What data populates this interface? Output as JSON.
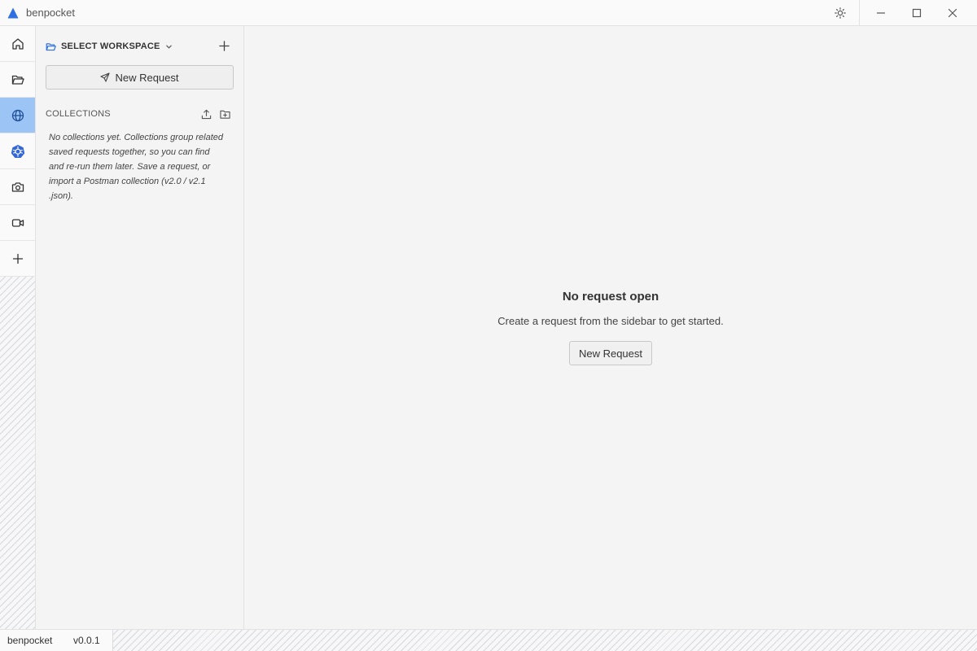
{
  "titlebar": {
    "app_name": "benpocket",
    "accent": "#2f6fe4",
    "icons": [
      "app-logo-icon",
      "sun-icon",
      "minimize-icon",
      "maximize-icon",
      "close-icon"
    ]
  },
  "iconbar": {
    "items": [
      {
        "name": "home-icon",
        "active": false
      },
      {
        "name": "folder-icon",
        "active": false
      },
      {
        "name": "globe-icon",
        "active": true
      },
      {
        "name": "kubernetes-icon",
        "active": false
      },
      {
        "name": "camera-icon",
        "active": false
      },
      {
        "name": "video-icon",
        "active": false
      },
      {
        "name": "plus-icon",
        "active": false
      }
    ],
    "active_color": "#9cc5f6"
  },
  "sidebar": {
    "workspace_label": "SELECT WORKSPACE",
    "new_request_label": "New Request",
    "collections_label": "COLLECTIONS",
    "empty_text": "No collections yet. Collections group related saved requests together, so you can find and re-run them later. Save a request, or import a Postman collection (v2.0 / v2.1 .json)."
  },
  "main": {
    "title": "No request open",
    "subtitle": "Create a request from the sidebar to get started.",
    "button_label": "New Request"
  },
  "statusbar": {
    "app_name": "benpocket",
    "version": "v0.0.1"
  }
}
